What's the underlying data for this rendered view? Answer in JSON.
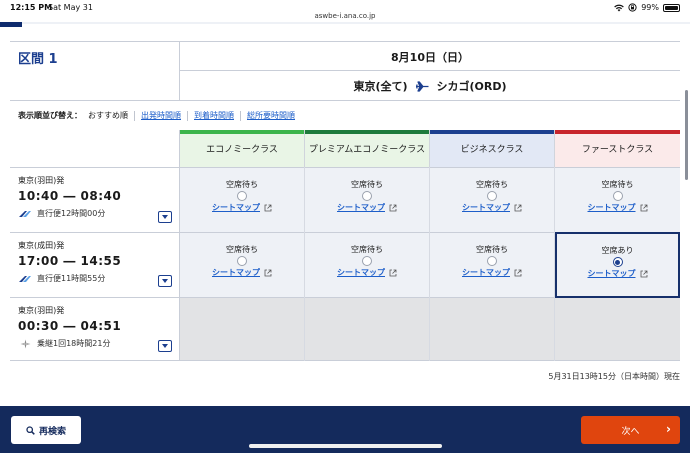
{
  "status_bar": {
    "time": "12:15 PM",
    "date": "Sat May 31",
    "url": "aswbe-i.ana.co.jp",
    "battery": "99%"
  },
  "segment": {
    "label": "区間 1",
    "date": "8月10日（日）",
    "origin": "東京(全て)",
    "destination": "シカゴ(ORD)"
  },
  "sort": {
    "label": "表示順並び替え：",
    "current": "おすすめ順",
    "options": [
      "出発時間順",
      "到着時間順",
      "総所要時間順"
    ]
  },
  "classes": [
    {
      "name": "エコノミークラス",
      "bar_color": "#3cb44b",
      "bg": "#e9f5e6"
    },
    {
      "name": "プレミアムエコノミークラス",
      "bar_color": "#1e7a3c",
      "bg": "#e9f5e6"
    },
    {
      "name": "ビジネスクラス",
      "bar_color": "#1c3f8f",
      "bg": "#e2e8f5"
    },
    {
      "name": "ファーストクラス",
      "bar_color": "#c8252c",
      "bg": "#fbeaea"
    }
  ],
  "flights": [
    {
      "dep_airport": "東京(羽田)発",
      "times": "10:40 ― 08:40",
      "info": "直行便12時間00分",
      "cells": [
        {
          "status": "空席待ち",
          "seatmap": "シートマップ"
        },
        {
          "status": "空席待ち",
          "seatmap": "シートマップ"
        },
        {
          "status": "空席待ち",
          "seatmap": "シートマップ"
        },
        {
          "status": "空席待ち",
          "seatmap": "シートマップ"
        }
      ]
    },
    {
      "dep_airport": "東京(成田)発",
      "times": "17:00 ― 14:55",
      "info": "直行便11時間55分",
      "cells": [
        {
          "status": "空席待ち",
          "seatmap": "シートマップ"
        },
        {
          "status": "空席待ち",
          "seatmap": "シートマップ"
        },
        {
          "status": "空席待ち",
          "seatmap": "シートマップ"
        },
        {
          "status": "空席あり",
          "seatmap": "シートマップ"
        }
      ]
    },
    {
      "dep_airport": "東京(羽田)発",
      "times": "00:30 ― 04:51",
      "info": "乗継1回18時間21分"
    }
  ],
  "updated": "5月31日13時15分（日本時間）現在",
  "buttons": {
    "research": "再検索",
    "next": "次へ"
  },
  "colors": {
    "navy": "#142a5c",
    "link": "#1d5ec9",
    "next": "#e0450e"
  }
}
